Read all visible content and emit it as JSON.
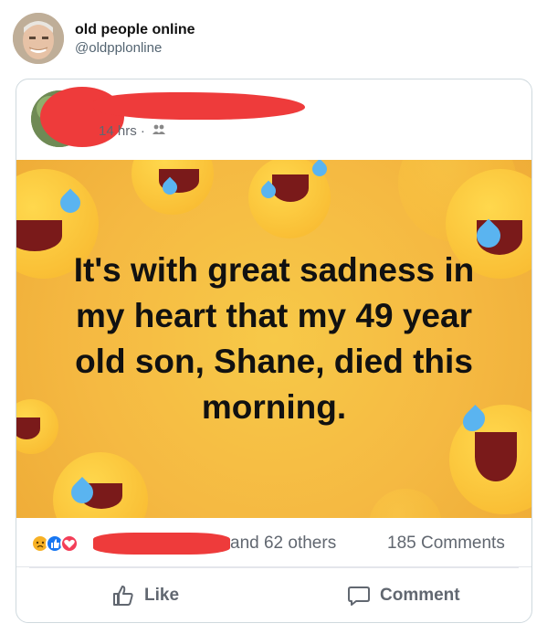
{
  "tweet": {
    "name": "old people online",
    "handle": "@oldpplonline"
  },
  "post": {
    "timestamp": "14 hrs",
    "separator": "·",
    "image_text": "It's with great sadness in my heart that my 49 year old son, Shane, died this morning."
  },
  "reactions": {
    "others_text": "and 62 others",
    "comments_text": "185 Comments"
  },
  "actions": {
    "like_label": "Like",
    "comment_label": "Comment"
  },
  "colors": {
    "redaction": "#ee3b3b",
    "image_background": "#f5b942",
    "like_blue": "#1877f2",
    "love_red": "#f33e58",
    "sad_yellow": "#f7b125"
  }
}
